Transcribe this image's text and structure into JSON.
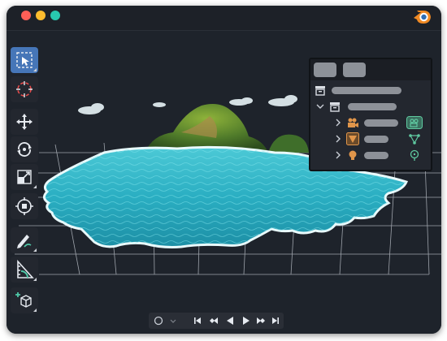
{
  "window": {
    "title_icon": "blender-logo",
    "traffic_lights": [
      "close",
      "minimize",
      "zoom"
    ],
    "colors": {
      "background": "#1b1f26",
      "accent": "#4676b8",
      "water": "#29b6c8",
      "logo_orange": "#f08a24",
      "logo_blue": "#2f6eb5"
    }
  },
  "toolbar": {
    "tools": [
      {
        "name": "select-box",
        "icon": "select-box-icon",
        "active": true
      },
      {
        "name": "cursor",
        "icon": "cursor-icon",
        "active": false
      },
      {
        "name": "move",
        "icon": "move-icon",
        "active": false
      },
      {
        "name": "rotate",
        "icon": "rotate-icon",
        "active": false
      },
      {
        "name": "scale",
        "icon": "scale-icon",
        "active": false
      },
      {
        "name": "transform",
        "icon": "transform-icon",
        "active": false
      },
      {
        "name": "annotate",
        "icon": "annotate-icon",
        "active": false
      },
      {
        "name": "measure",
        "icon": "measure-icon",
        "active": false
      },
      {
        "name": "add-cube",
        "icon": "add-cube-icon",
        "active": false
      }
    ]
  },
  "outliner": {
    "tabs": [
      "tab-1",
      "tab-2"
    ],
    "rows": [
      {
        "icon": "scene-collection-icon",
        "expanded": null
      },
      {
        "icon": "collection-icon",
        "expanded": true
      },
      {
        "icon": "camera-icon",
        "data_icon": "camera-data-icon",
        "expanded": false
      },
      {
        "icon": "mesh-icon",
        "data_icon": "vertex-data-icon",
        "expanded": false
      },
      {
        "icon": "light-icon",
        "data_icon": "light-data-icon",
        "expanded": false
      }
    ]
  },
  "playback": {
    "controls": [
      "record-icon",
      "keying-dropdown-icon",
      "jump-start-icon",
      "prev-keyframe-icon",
      "play-reverse-icon",
      "play-icon",
      "next-keyframe-icon",
      "jump-end-icon"
    ]
  }
}
